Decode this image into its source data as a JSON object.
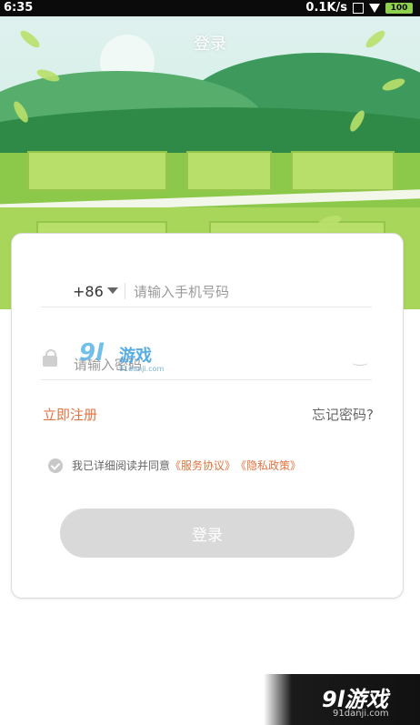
{
  "status_bar": {
    "time": "6:35",
    "speed": "0.1K/s",
    "battery": "100"
  },
  "header": {
    "title": "登录"
  },
  "login": {
    "country_code": "+86",
    "phone_placeholder": "请输入手机号码",
    "password_placeholder": "请输入密码",
    "register_label": "立即注册",
    "forgot_label": "忘记密码?",
    "agreement_prefix": "我已详细阅读并同意",
    "terms_label": "《服务协议》",
    "privacy_label": "《隐私政策》",
    "submit_label": "登录"
  },
  "watermark": {
    "logo": "9l游戏",
    "site": "91danji.com",
    "card_logo": "9l",
    "card_cn": "游戏",
    "card_site": "91danji.com"
  },
  "colors": {
    "accent": "#e07440",
    "button_disabled": "#d9d9d9"
  }
}
